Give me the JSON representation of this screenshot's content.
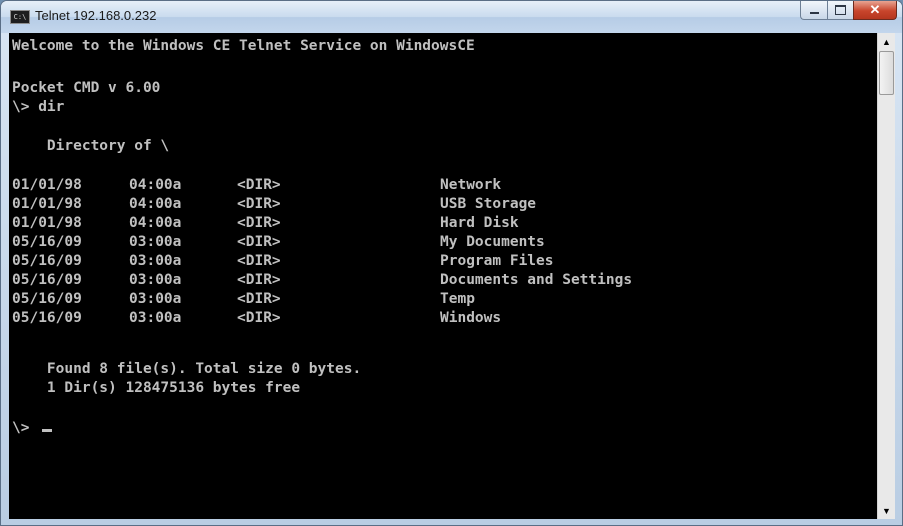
{
  "window": {
    "title": "Telnet 192.168.0.232",
    "icon": "console-icon",
    "icon_text": "C:\\",
    "buttons": {
      "minimize": "minimize-icon",
      "maximize": "maximize-icon",
      "close": "close-icon",
      "close_glyph": "✕"
    }
  },
  "console": {
    "welcome": "Welcome to the Windows CE Telnet Service on WindowsCE",
    "version": "Pocket CMD v 6.00",
    "command_line": "\\> dir",
    "directory_header": "    Directory of \\",
    "entries": [
      {
        "date": "01/01/98",
        "time": "04:00a",
        "type": "<DIR>",
        "name": "Network"
      },
      {
        "date": "01/01/98",
        "time": "04:00a",
        "type": "<DIR>",
        "name": "USB Storage"
      },
      {
        "date": "01/01/98",
        "time": "04:00a",
        "type": "<DIR>",
        "name": "Hard Disk"
      },
      {
        "date": "05/16/09",
        "time": "03:00a",
        "type": "<DIR>",
        "name": "My Documents"
      },
      {
        "date": "05/16/09",
        "time": "03:00a",
        "type": "<DIR>",
        "name": "Program Files"
      },
      {
        "date": "05/16/09",
        "time": "03:00a",
        "type": "<DIR>",
        "name": "Documents and Settings"
      },
      {
        "date": "05/16/09",
        "time": "03:00a",
        "type": "<DIR>",
        "name": "Temp"
      },
      {
        "date": "05/16/09",
        "time": "03:00a",
        "type": "<DIR>",
        "name": "Windows"
      }
    ],
    "summary_files": "    Found 8 file(s). Total size 0 bytes.",
    "summary_dirs": "    1 Dir(s) 128475136 bytes free",
    "prompt": "\\>",
    "text_color": "#c0c0c0",
    "background_color": "#000000"
  },
  "scrollbar": {
    "up_arrow": "▲",
    "down_arrow": "▼"
  }
}
